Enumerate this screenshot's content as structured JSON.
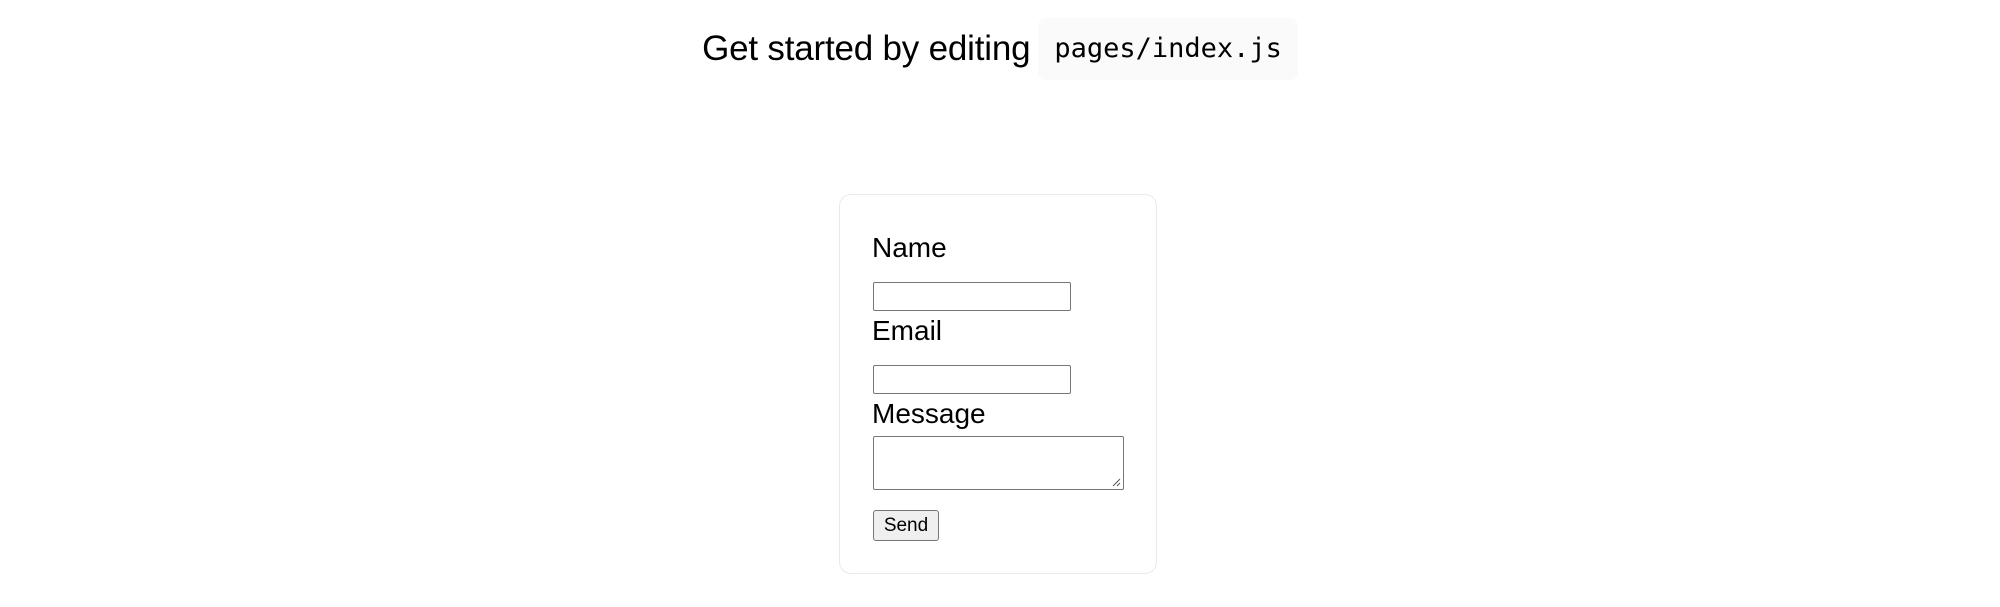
{
  "intro": {
    "text": "Get started by editing",
    "code": "pages/index.js"
  },
  "contact_form": {
    "name_label": "Name",
    "name_value": "",
    "email_label": "Email",
    "email_value": "",
    "message_label": "Message",
    "message_value": "",
    "send_label": "Send"
  }
}
